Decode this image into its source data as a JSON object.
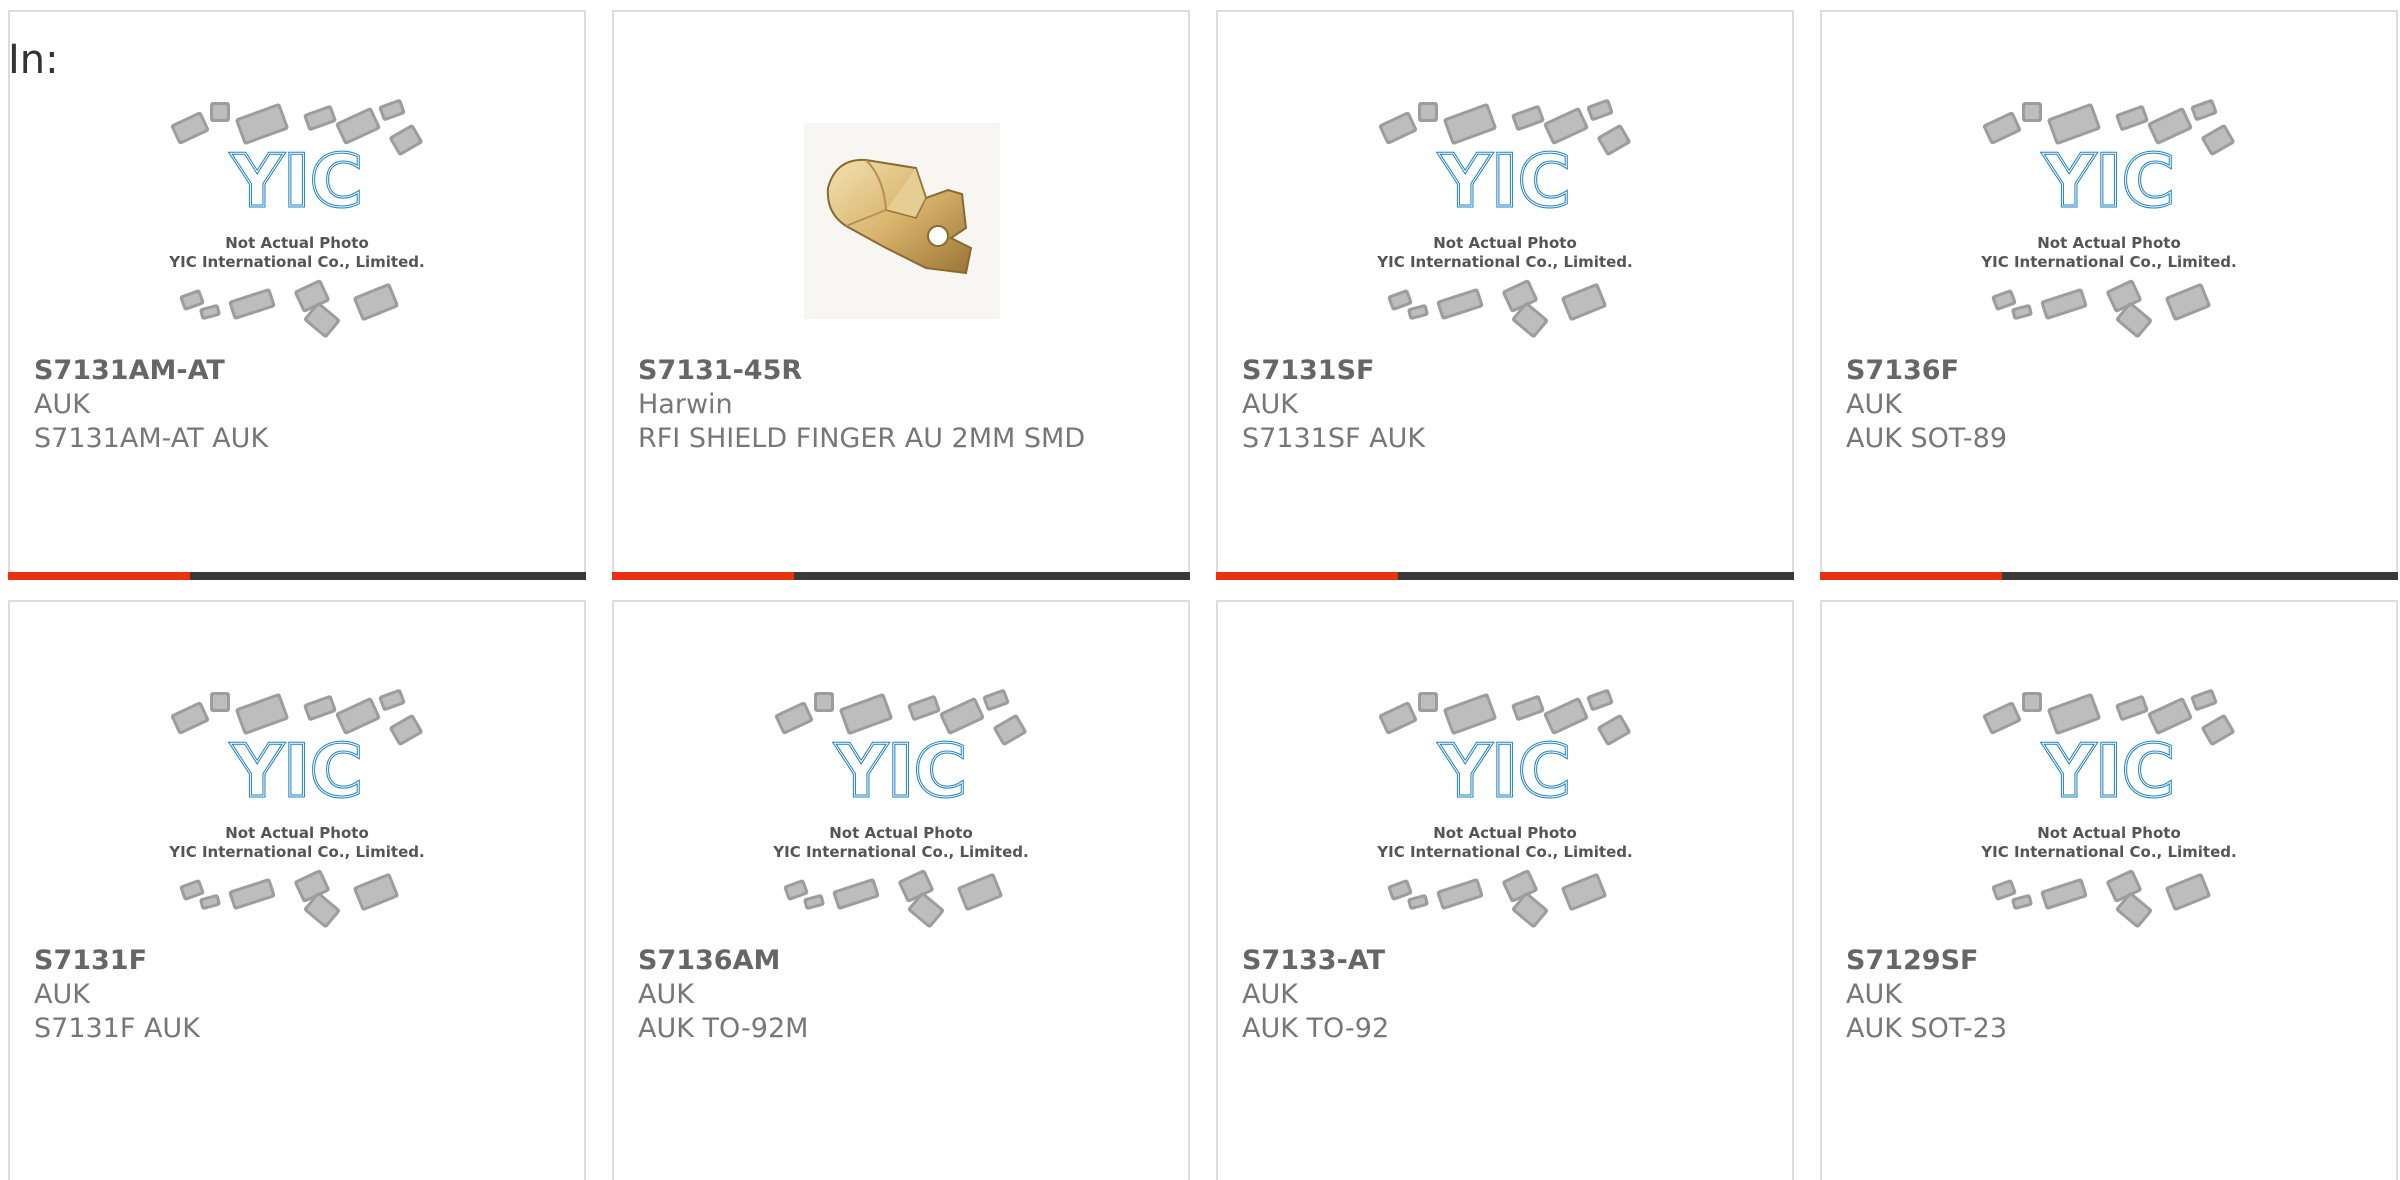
{
  "heading": "In:",
  "placeholder_image": {
    "line1": "Not Actual Photo",
    "line2": "YIC International Co., Limited.",
    "logo_text": "YIC"
  },
  "colors": {
    "accent": "#e8330e",
    "bar_dark": "#3a3a3a",
    "logo_blue": "#1a7fc4",
    "card_border": "#dddddd"
  },
  "products": [
    {
      "part": "S7131AM-AT",
      "manufacturer": "AUK",
      "description": "S7131AM-AT AUK",
      "image": "placeholder"
    },
    {
      "part": "S7131-45R",
      "manufacturer": "Harwin",
      "description": "RFI SHIELD FINGER AU 2MM SMD",
      "image": "shield-finger-photo"
    },
    {
      "part": "S7131SF",
      "manufacturer": "AUK",
      "description": "S7131SF AUK",
      "image": "placeholder"
    },
    {
      "part": "S7136F",
      "manufacturer": "AUK",
      "description": "AUK SOT-89",
      "image": "placeholder"
    },
    {
      "part": "S7131F",
      "manufacturer": "AUK",
      "description": "S7131F AUK",
      "image": "placeholder"
    },
    {
      "part": "S7136AM",
      "manufacturer": "AUK",
      "description": "AUK TO-92M",
      "image": "placeholder"
    },
    {
      "part": "S7133-AT",
      "manufacturer": "AUK",
      "description": "AUK TO-92",
      "image": "placeholder"
    },
    {
      "part": "S7129SF",
      "manufacturer": "AUK",
      "description": "AUK SOT-23",
      "image": "placeholder"
    }
  ]
}
